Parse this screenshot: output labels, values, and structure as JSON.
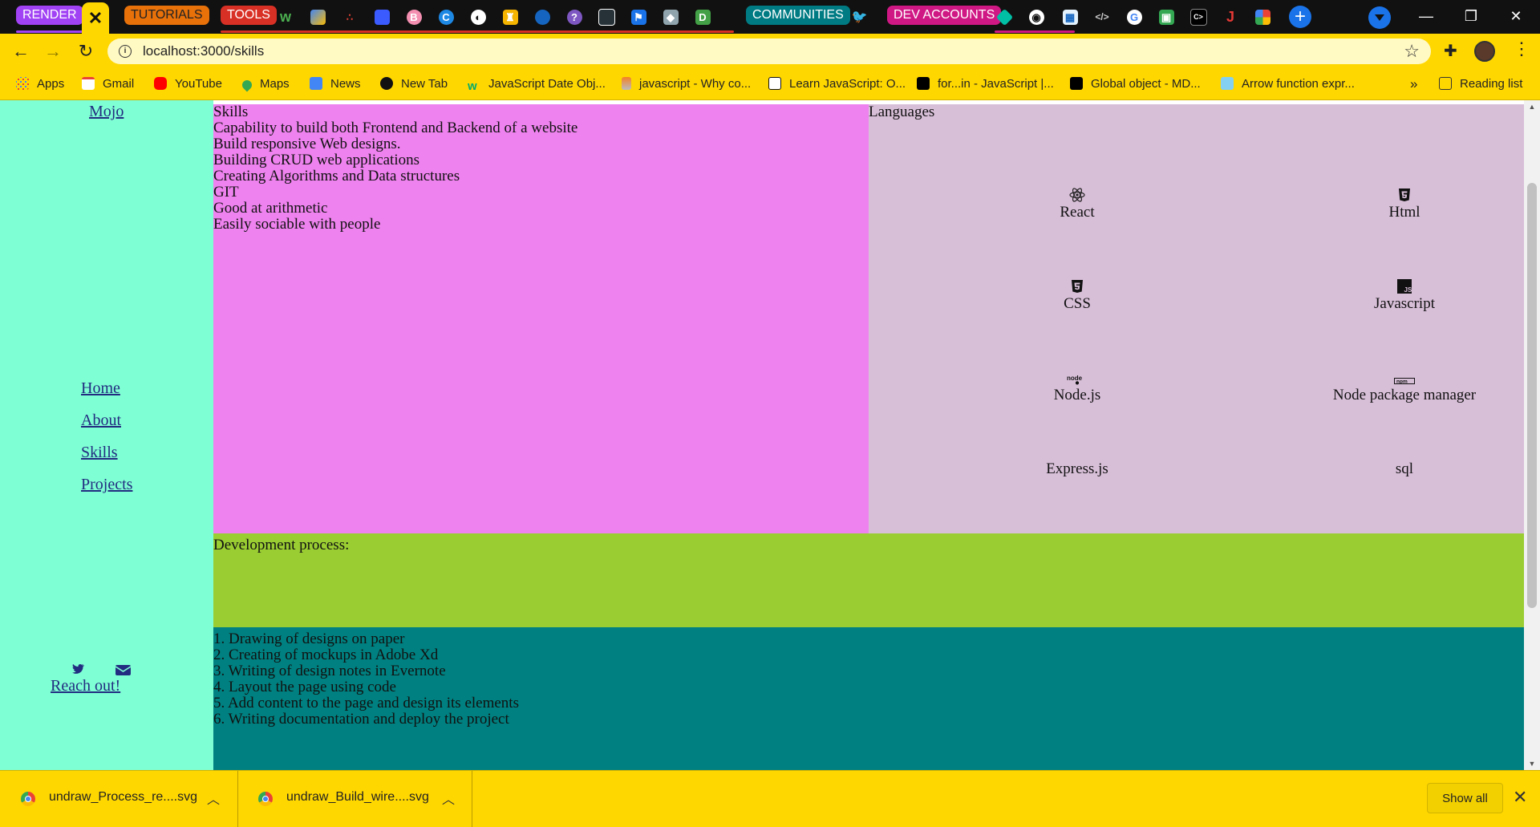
{
  "browser": {
    "tab_groups": [
      {
        "label": "RENDER",
        "color": "#a142f4"
      },
      {
        "label": "TUTORIALS",
        "color": "#e8710a"
      },
      {
        "label": "TOOLS",
        "color": "#d93025"
      },
      {
        "label": "COMMUNITIES",
        "color": "#007b83"
      },
      {
        "label": "DEV ACCOUNTS",
        "color": "#d01884"
      }
    ],
    "active_tab_close": "✕",
    "new_tab": "+",
    "window_controls": {
      "minimize": "—",
      "restore": "❐",
      "close": "✕"
    },
    "address": "localhost:3000/skills",
    "bookmarks": [
      {
        "label": "Apps",
        "icon": "apps-grid-icon"
      },
      {
        "label": "Gmail",
        "icon": "gmail-icon"
      },
      {
        "label": "YouTube",
        "icon": "youtube-icon"
      },
      {
        "label": "Maps",
        "icon": "maps-icon"
      },
      {
        "label": "News",
        "icon": "news-icon"
      },
      {
        "label": "New Tab",
        "icon": "globe-icon"
      },
      {
        "label": "JavaScript Date Obj...",
        "icon": "w3schools-icon"
      },
      {
        "label": "javascript - Why co...",
        "icon": "stackoverflow-icon"
      },
      {
        "label": "Learn JavaScript: O...",
        "icon": "codecademy-icon"
      },
      {
        "label": "for...in - JavaScript |...",
        "icon": "mdn-icon"
      },
      {
        "label": "Global object - MD...",
        "icon": "mdn-icon"
      },
      {
        "label": "Arrow function expr...",
        "icon": "mdn-blue-icon"
      }
    ],
    "bookmarks_overflow": "»",
    "reading_list": "Reading list"
  },
  "sidebar": {
    "brand": "Mojo",
    "nav": [
      "Home",
      "About",
      "Skills",
      "Projects"
    ],
    "social_icons": [
      "twitter-icon",
      "envelope-icon"
    ],
    "reach_out": "Reach out!"
  },
  "skills": {
    "heading": "Skills",
    "items": [
      "Capability to build both Frontend and Backend of a website",
      "Build responsive Web designs.",
      "Building CRUD web applications",
      "Creating Algorithms and Data structures",
      "GIT",
      "Good at arithmetic",
      "Easily sociable with people"
    ]
  },
  "languages": {
    "heading": "Languages",
    "items": [
      {
        "label": "React",
        "icon": "react-icon"
      },
      {
        "label": "Html",
        "icon": "html5-icon"
      },
      {
        "label": "CSS",
        "icon": "css3-icon"
      },
      {
        "label": "Javascript",
        "icon": "javascript-icon"
      },
      {
        "label": "Node.js",
        "icon": "nodejs-icon"
      },
      {
        "label": "Node package manager",
        "icon": "npm-icon"
      },
      {
        "label": "Express.js",
        "icon": ""
      },
      {
        "label": "sql",
        "icon": ""
      }
    ]
  },
  "development": {
    "heading": "Development process:",
    "steps": [
      "1. Drawing of designs on paper",
      "2. Creating of mockups in Adobe Xd",
      "3. Writing of design notes in Evernote",
      "4. Layout the page using code",
      "5. Add content to the page and design its elements",
      "6. Writing documentation and deploy the project"
    ]
  },
  "downloads": {
    "files": [
      "undraw_Process_re....svg",
      "undraw_Build_wire....svg"
    ],
    "show_all": "Show all",
    "close": "✕"
  },
  "colors": {
    "chrome_yellow": "#FFD700",
    "sidebar": "#7FFFD4",
    "skills_panel": "#EE82EE",
    "languages_panel": "#D8BFD8",
    "dev_panel": "#9ACD32",
    "steps_panel": "#008080"
  }
}
